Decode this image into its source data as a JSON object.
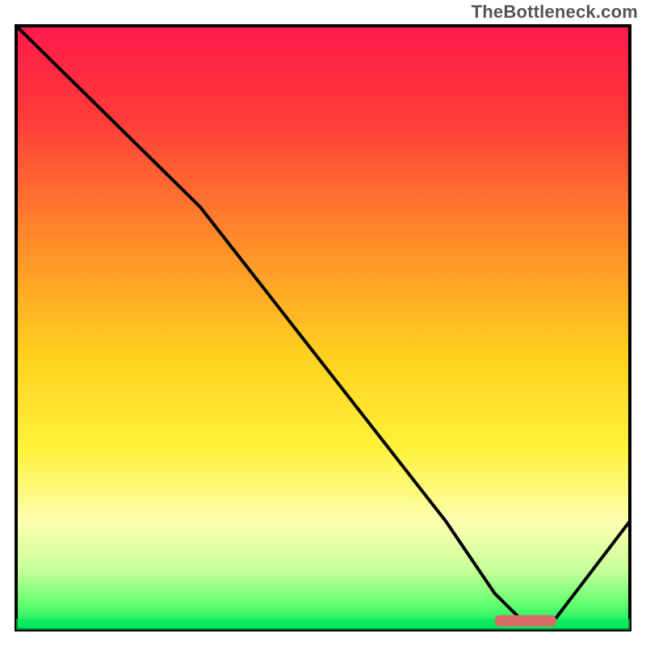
{
  "watermark": "TheBottleneck.com",
  "chart_data": {
    "type": "line",
    "title": "",
    "xlabel": "",
    "ylabel": "",
    "xlim": [
      0,
      100
    ],
    "ylim": [
      0,
      100
    ],
    "gradient_stops": [
      {
        "offset": 0,
        "color": "#ff1a4b"
      },
      {
        "offset": 15,
        "color": "#ff3a3a"
      },
      {
        "offset": 35,
        "color": "#ff8a2a"
      },
      {
        "offset": 55,
        "color": "#ffd21f"
      },
      {
        "offset": 70,
        "color": "#fff23a"
      },
      {
        "offset": 82,
        "color": "#fdffb0"
      },
      {
        "offset": 90,
        "color": "#c9ff9a"
      },
      {
        "offset": 96,
        "color": "#5eff6e"
      },
      {
        "offset": 100,
        "color": "#00e85e"
      }
    ],
    "series": [
      {
        "name": "curve",
        "x": [
          0,
          10,
          22,
          30,
          40,
          50,
          60,
          70,
          78,
          82,
          88,
          100
        ],
        "y": [
          100,
          90,
          78,
          70,
          57,
          44,
          31,
          18,
          6,
          2,
          2,
          18
        ]
      }
    ],
    "optimal_marker": {
      "x_start": 78,
      "x_end": 88,
      "y": 1.5,
      "color": "#d96a6a"
    },
    "border_color": "#000000"
  }
}
